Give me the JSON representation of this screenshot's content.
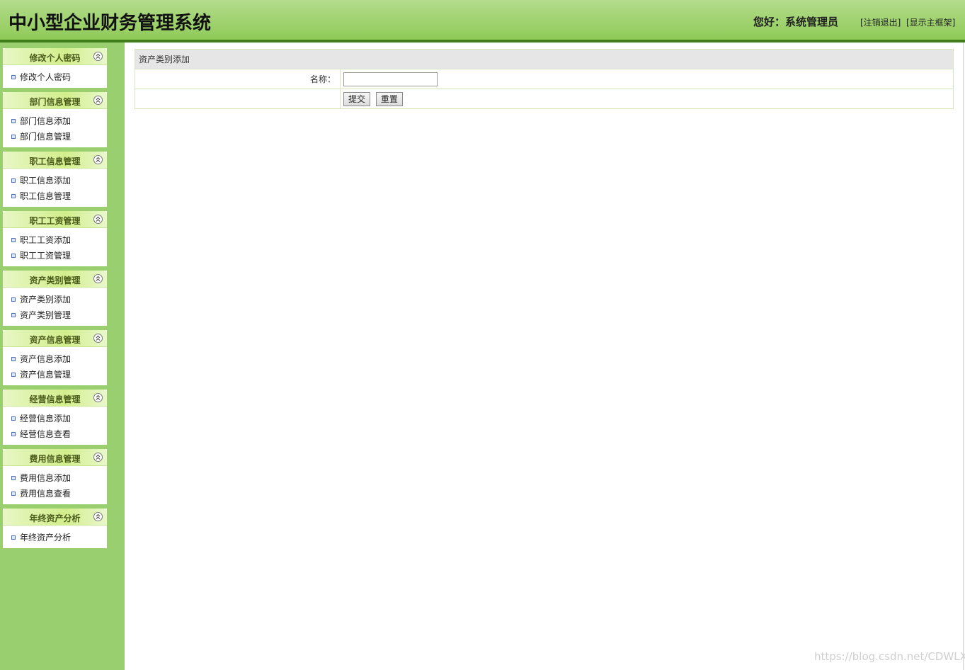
{
  "header": {
    "title": "中小型企业财务管理系统",
    "greeting": "您好：系统管理员",
    "logout_link": "[注销退出]",
    "show_frame_link": "[显示主框架]"
  },
  "sidebar": {
    "panels": [
      {
        "title": "修改个人密码",
        "items": [
          "修改个人密码"
        ]
      },
      {
        "title": "部门信息管理",
        "items": [
          "部门信息添加",
          "部门信息管理"
        ]
      },
      {
        "title": "职工信息管理",
        "items": [
          "职工信息添加",
          "职工信息管理"
        ]
      },
      {
        "title": "职工工资管理",
        "items": [
          "职工工资添加",
          "职工工资管理"
        ]
      },
      {
        "title": "资产类别管理",
        "items": [
          "资产类别添加",
          "资产类别管理"
        ]
      },
      {
        "title": "资产信息管理",
        "items": [
          "资产信息添加",
          "资产信息管理"
        ]
      },
      {
        "title": "经营信息管理",
        "items": [
          "经营信息添加",
          "经营信息查看"
        ]
      },
      {
        "title": "费用信息管理",
        "items": [
          "费用信息添加",
          "费用信息查看"
        ]
      },
      {
        "title": "年终资产分析",
        "items": [
          "年终资产分析"
        ]
      }
    ]
  },
  "form": {
    "heading": "资产类别添加",
    "name_label": "名称：",
    "name_value": "",
    "submit_label": "提交",
    "reset_label": "重置"
  },
  "watermark": "https://blog.csdn.net/CDWLX",
  "colors": {
    "header_top": "#b3dc8c",
    "header_bottom": "#8fca58",
    "header_line": "#3f7d1a",
    "sidebar_bg": "#99cf6e",
    "form_header_bg": "#e6e6e6"
  },
  "icons": {
    "panel_toggle": "double-chevron-up-icon",
    "menu_bullet": "square-bullet-icon"
  }
}
